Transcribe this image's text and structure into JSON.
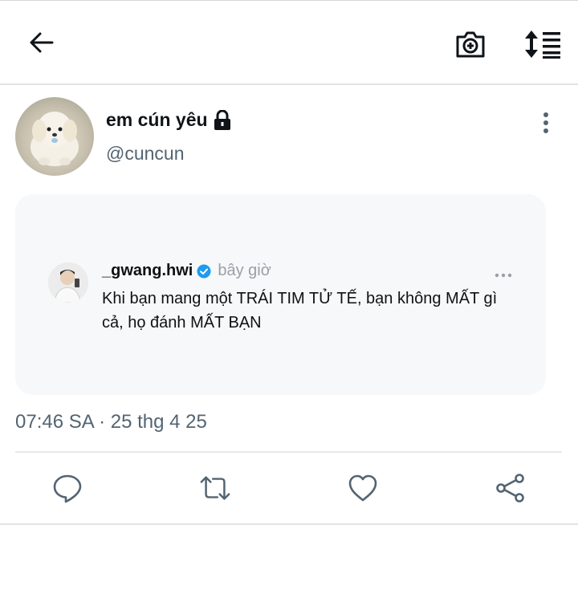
{
  "header": {
    "back_icon": "arrow-left-icon",
    "camera_icon": "camera-plus-icon",
    "sort_icon": "sort-list-icon"
  },
  "tweet": {
    "display_name": "em cún yêu",
    "lock_icon": "lock-icon",
    "handle": "@cuncun",
    "timestamp": "07:46 SA · 25 thg 4 25"
  },
  "quoted_post": {
    "username": "_gwang.hwi",
    "verified_icon": "verified-badge-icon",
    "time": "bây giờ",
    "text": "Khi bạn mang một TRÁI TIM TỬ TẾ, bạn không MẤT gì cả, họ đánh MẤT BẠN"
  },
  "actions": [
    {
      "name": "reply",
      "icon": "reply-icon"
    },
    {
      "name": "retweet",
      "icon": "retweet-icon"
    },
    {
      "name": "like",
      "icon": "heart-icon"
    },
    {
      "name": "share",
      "icon": "share-icon"
    }
  ],
  "colors": {
    "text_primary": "#0f1419",
    "text_secondary": "#536471",
    "card_bg": "#f7f8f9",
    "verified_blue": "#1d9bf0",
    "icon_gray": "#536471"
  }
}
